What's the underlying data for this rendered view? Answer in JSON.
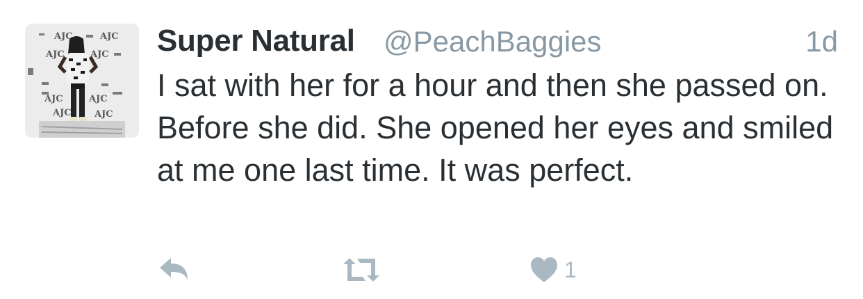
{
  "tweet": {
    "display_name": "Super Natural",
    "handle": "@PeachBaggies",
    "timestamp": "1d",
    "text": "I sat with her for a hour and then she passed on. Before she did. She opened her eyes and smiled at me one last time. It was perfect.",
    "avatar": {
      "icon": "profile-photo",
      "backdrop_text": "AJC"
    },
    "actions": {
      "reply_icon": "reply-icon",
      "retweet_icon": "retweet-icon",
      "like_icon": "heart-icon",
      "like_count": "1"
    }
  },
  "colors": {
    "name": "#292f33",
    "secondary": "#8899a6",
    "action": "#aab8c2",
    "avatar_bg": "#ececed"
  }
}
